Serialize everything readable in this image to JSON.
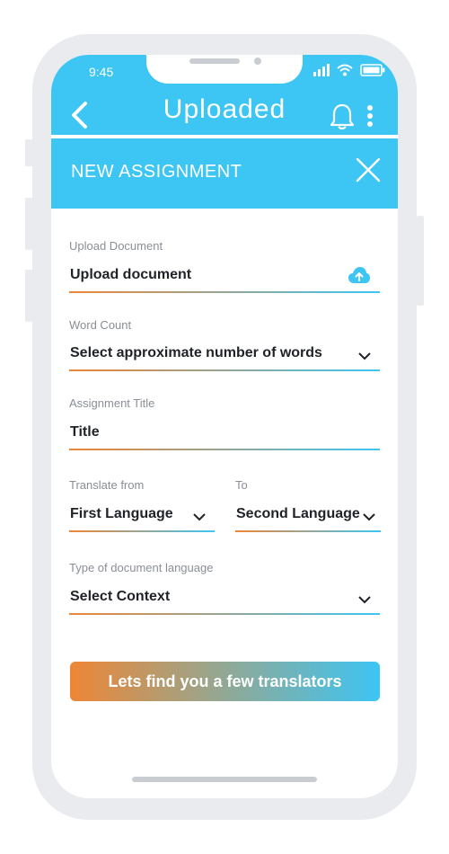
{
  "status_bar": {
    "time": "9:45"
  },
  "app_bar": {
    "title": "Uploaded"
  },
  "modal": {
    "title": "NEW ASSIGNMENT"
  },
  "form": {
    "upload": {
      "label": "Upload Document",
      "value": "Upload document"
    },
    "word_count": {
      "label": "Word Count",
      "value": "Select approximate number of words"
    },
    "assignment_title": {
      "label": "Assignment Title",
      "value": "Title"
    },
    "translate_from": {
      "label": "Translate from",
      "value": "First Language"
    },
    "translate_to": {
      "label": "To",
      "value": "Second Language"
    },
    "doc_type": {
      "label": "Type of document language",
      "value": "Select Context"
    }
  },
  "cta": {
    "label": "Lets find you a few translators"
  },
  "colors": {
    "brand_blue": "#3dc5f3",
    "accent_orange": "#ee8636",
    "frame_gray": "#e9ebee"
  },
  "icons": [
    "back-icon",
    "bell-icon",
    "more-vert-icon",
    "close-icon",
    "cloud-upload-icon",
    "chevron-down-icon",
    "signal-icon",
    "wifi-icon",
    "battery-icon"
  ]
}
